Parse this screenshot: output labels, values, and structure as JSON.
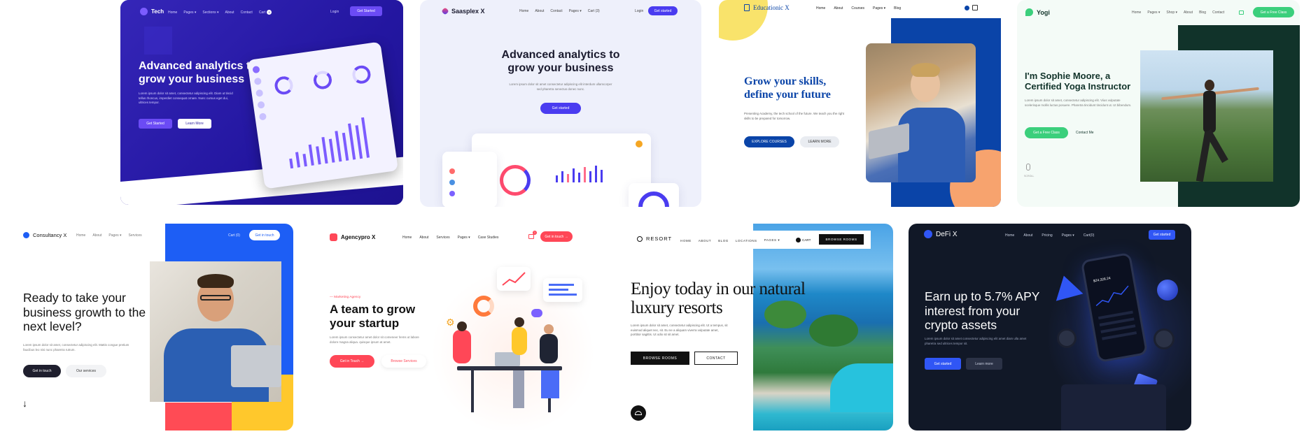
{
  "colors": {
    "tech_bg": "#2b1f9e",
    "tech_accent": "#6b4bf5",
    "saasplex_bg": "#eef0fb",
    "saasplex_accent": "#4a3cf0",
    "educationic_blue": "#0a44a8",
    "educationic_yellow": "#f9e36b",
    "educationic_orange": "#f7a36e",
    "yogi_green": "#3bcf7c",
    "yogi_dark": "#11332a",
    "consultancy_blue": "#1d5ef5",
    "consultancy_yellow": "#ffc82c",
    "consultancy_red": "#ff4b55",
    "agencypro_red": "#ff4757",
    "resort_dark": "#111111",
    "defi_bg": "#111827",
    "defi_accent": "#3056f5"
  },
  "tech": {
    "logo": "Tech",
    "nav": [
      "Home",
      "Pages ▾",
      "Sections ▾",
      "About",
      "Contact",
      "Cart"
    ],
    "cart_count": "0",
    "login": "Login",
    "cta": "Get Started",
    "title": "Advanced analytics to grow your business",
    "text": "Lorem ipsum dolor sit amet, consectetur adipiscing elit. Diam ut tincid tellus rhoncus, imperdiet consequat ornare. Nunc cursus eget dui, ultrices tempor.",
    "btn_primary": "Get Started",
    "btn_secondary": "Learn More"
  },
  "saasplex": {
    "logo": "Saasplex X",
    "nav": [
      "Home",
      "About",
      "Contact",
      "Pages ▾",
      "Cart (3)"
    ],
    "login": "Login",
    "cta": "Get started",
    "title": "Advanced analytics to grow your business",
    "text": "Lorem ipsum dolor sit amet consectetur adipiscing elit interdum ullamcorper sed pharetra senectus donec nunc.",
    "btn": "Get started"
  },
  "educationic": {
    "logo": "Educationic X",
    "nav": [
      "Home",
      "About",
      "Courses",
      "Pages ▾",
      "Blog"
    ],
    "title": "Grow your skills, define your future",
    "text": "Presenting Academy, the tech school of the future. We teach you the right skills to be prepared for tomorrow.",
    "btn_primary": "EXPLORE COURSES",
    "btn_secondary": "LEARN MORE"
  },
  "yogi": {
    "logo": "Yogi",
    "nav": [
      "Home",
      "Pages ▾",
      "Shop ▾",
      "About",
      "Blog",
      "Contact"
    ],
    "cta": "Get a Free Class",
    "title": "I'm Sophie Moore, a Certified Yoga Instructor",
    "text": "Lorem ipsum dolor sit amet, consectetur adipiscing elit. Viius vulputate scelerisque mollis luctus posuere. Pharetra tincidunt tincidunt ut. Ut bibendum.",
    "btn_primary": "Get a Free Class",
    "btn_secondary": "Contact Me",
    "scroll": "SCROLL"
  },
  "consultancy": {
    "logo": "Consultancy X",
    "nav": [
      "Home",
      "About",
      "Pages ▾",
      "Services"
    ],
    "cart": "Cart (0)",
    "cta": "Get in touch",
    "title": "Ready to take your business growth to the next level?",
    "text": "Lorem ipsum dolor sit amet, consectetur adipiscing elit. Mattis congue pretium faucibus leo nisi nunc pharetra rutrum.",
    "btn_primary": "Get in touch",
    "btn_secondary": "Our services"
  },
  "agencypro": {
    "logo": "Agencypro X",
    "nav": [
      "Home",
      "About",
      "Services",
      "Pages ▾",
      "Case Studies"
    ],
    "cart_count": "1",
    "cta": "Get in touch →",
    "eyebrow": "— Marketing Agency",
    "title": "A team to grow your startup",
    "text": "Lorem ipsum consectetur amet dolor sit comeneer lrems ut labore dolore magna aliqua. quisque ipsum at amet.",
    "btn_primary": "Get in Touch →",
    "btn_secondary": "Browse Services"
  },
  "resort": {
    "logo": "RESORT",
    "nav": [
      "HOME",
      "ABOUT",
      "BLOG",
      "LOCATIONS",
      "PAGES ▾"
    ],
    "cart": "CART",
    "cta": "BROWSE ROOMS",
    "title": "Enjoy today in our natural luxury resorts",
    "text": "Lorem ipsum dolor sit amet, consectetur adipiscing elit. Ut a tempus, sit euismod aliquet nec, sit. Eu ne a aliquam viverra vulputate amet, porttitor sagittis. Ut odio sit sit amet.",
    "btn_primary": "BROWSE ROOMS",
    "btn_secondary": "CONTACT"
  },
  "defi": {
    "logo": "DeFi X",
    "nav": [
      "Home",
      "About",
      "Pricing",
      "Pages ▾",
      "Cart(0)"
    ],
    "cta": "Get started",
    "title": "Earn up to 5.7% APY interest from your crypto assets",
    "text": "Lorem ipsum dolor sit amet consectetur adipiscing elit amet diam ulla amet pharetra sed ultrices tempor sit.",
    "btn_primary": "Get started",
    "btn_secondary": "Learn more",
    "balance": "$24,328.24"
  }
}
